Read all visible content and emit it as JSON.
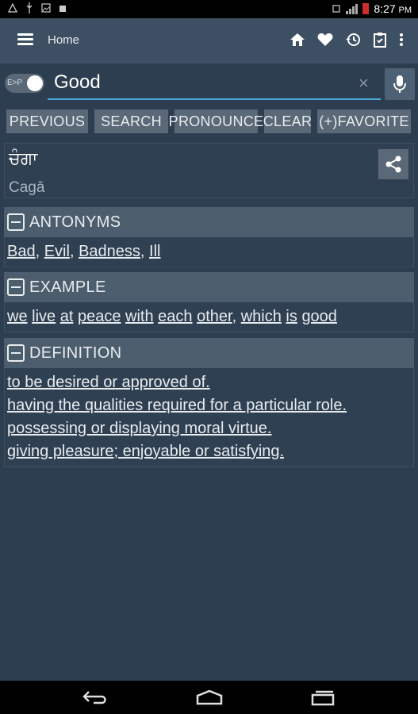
{
  "status_bar": {
    "time": "8:27",
    "time_suffix": "PM"
  },
  "toolbar": {
    "title": "Home",
    "icons": [
      "menu-icon",
      "home-icon",
      "heart-icon",
      "history-icon",
      "clipboard-icon",
      "more-vert-icon"
    ]
  },
  "search": {
    "toggle_label": "E>P",
    "value": "Good",
    "clear_glyph": "×"
  },
  "actions": {
    "previous": "PREVIOUS",
    "search": "SEARCH",
    "pronounce": "PRONOUNCE",
    "clear": "CLEAR",
    "favorite": "(+)FAVORITE"
  },
  "word": {
    "native": "ਚੰਗਾ",
    "transliteration": "Cagā"
  },
  "sections": {
    "antonyms": {
      "title": "ANTONYMS",
      "items": [
        "Bad",
        "Evil",
        "Badness",
        "Ill"
      ]
    },
    "example": {
      "title": "EXAMPLE",
      "words": [
        "we",
        "live",
        "at",
        "peace",
        "with",
        "each",
        "other",
        "which",
        "is",
        "good"
      ],
      "text": "we live at peace with each other, which is good"
    },
    "definition": {
      "title": "DEFINITION",
      "lines": [
        "to be desired or approved of.",
        "having the qualities required for a particular role.",
        "possessing or displaying moral virtue.",
        "giving pleasure; enjoyable or satisfying."
      ]
    }
  },
  "colors": {
    "background": "#2d3e50",
    "toolbar": "#3d4f62",
    "section_header": "#4c5d6e",
    "button": "#5a6877",
    "accent": "#4aa8d8",
    "battery": "#cc2e2e"
  }
}
